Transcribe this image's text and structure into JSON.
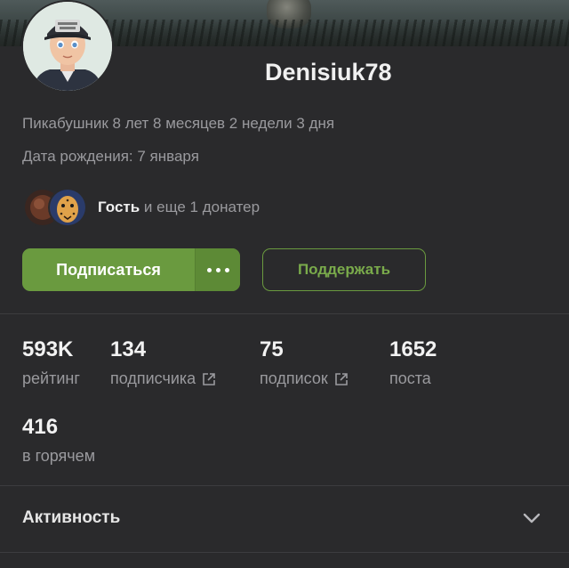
{
  "profile": {
    "username": "Denisiuk78",
    "member_since": "Пикабушник 8 лет 8 месяцев 2 недели 3 дня",
    "birthday": "Дата рождения: 7 января"
  },
  "donors": {
    "first": "Гость",
    "rest": " и еще 1 донатер"
  },
  "actions": {
    "subscribe_label": "Подписаться",
    "support_label": "Поддержать",
    "more_icon": "more-dots-icon"
  },
  "stats": [
    {
      "value": "593K",
      "label": "рейтинг"
    },
    {
      "value": "134",
      "label": "подписчика"
    },
    {
      "value": "75",
      "label": "подписок"
    },
    {
      "value": "1652",
      "label": "поста"
    },
    {
      "value": "416",
      "label": "в горячем"
    }
  ],
  "activity": {
    "title": "Активность"
  },
  "colors": {
    "accent": "#6a9a3f",
    "background": "#2a2a2c",
    "muted_text": "#9a9a9e"
  }
}
